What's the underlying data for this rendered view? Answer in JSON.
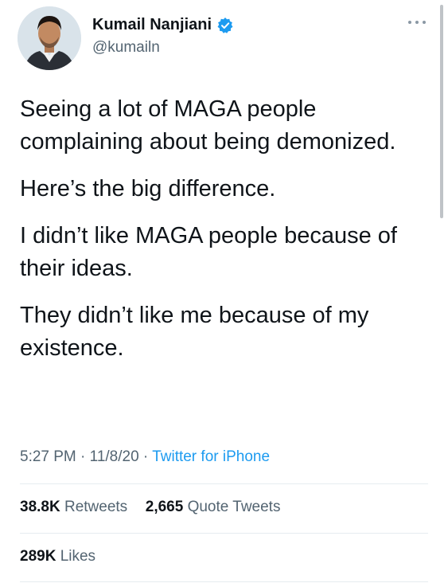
{
  "user": {
    "display_name": "Kumail Nanjiani",
    "handle": "@kumailn",
    "verified": true
  },
  "tweet": {
    "paragraphs": [
      "Seeing a lot of MAGA people complaining about being demonized.",
      "Here’s the big difference.",
      "I didn’t like MAGA people because of their ideas.",
      "They didn’t like me because of my existence."
    ],
    "time": "5:27 PM",
    "date": "11/8/20",
    "separator": "·",
    "source": "Twitter for iPhone"
  },
  "stats": {
    "retweets": {
      "count": "38.8K",
      "label": "Retweets"
    },
    "quote_tweets": {
      "count": "2,665",
      "label": "Quote Tweets"
    },
    "likes": {
      "count": "289K",
      "label": "Likes"
    }
  },
  "icons": {
    "verified": "verified-badge-icon",
    "more": "more-options-icon"
  },
  "colors": {
    "link_blue": "#1d9bf0",
    "secondary_text": "#536471",
    "primary_text": "#0f1419",
    "divider": "#e6ecf0"
  }
}
